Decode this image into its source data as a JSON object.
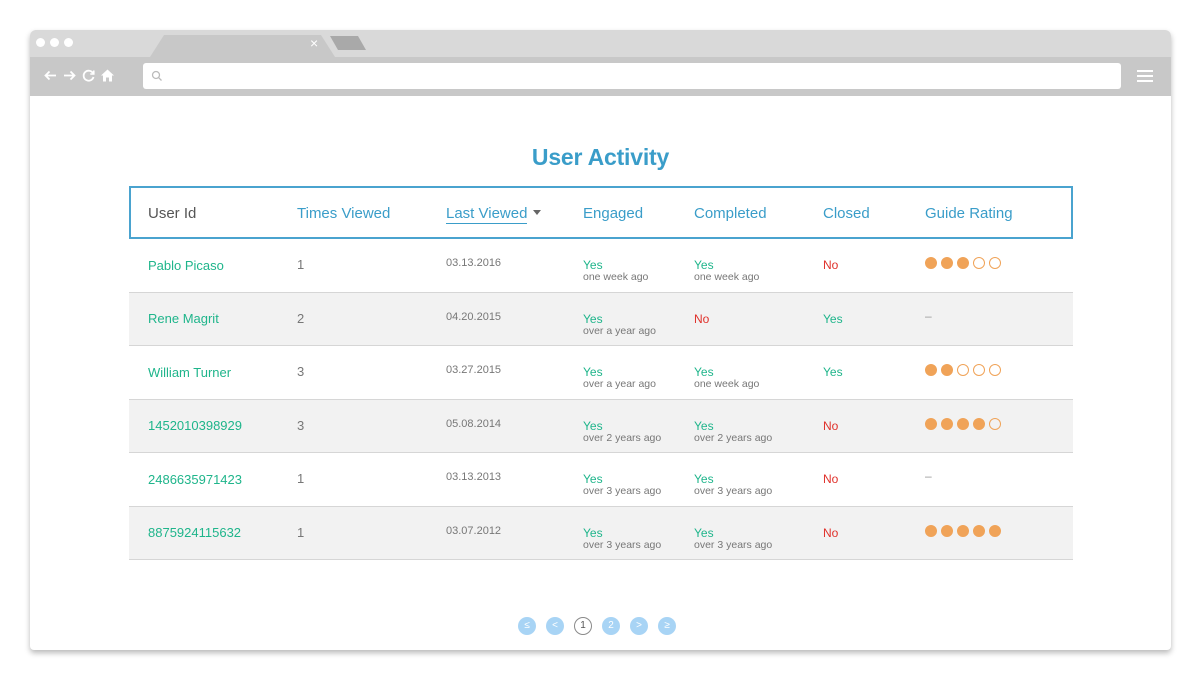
{
  "browser": {
    "tab_close": "×",
    "url_value": "",
    "icons": [
      "back-arrow-icon",
      "forward-arrow-icon",
      "reload-icon",
      "home-icon",
      "search-icon",
      "hamburger-menu-icon"
    ]
  },
  "page": {
    "title": "User Activity"
  },
  "table": {
    "headers": {
      "user_id": "User Id",
      "times_viewed": "Times Viewed",
      "last_viewed": "Last Viewed",
      "engaged": "Engaged",
      "completed": "Completed",
      "closed": "Closed",
      "guide_rating": "Guide Rating"
    },
    "sorted_column": "last_viewed",
    "sort_direction": "descending",
    "rows": [
      {
        "user": "Pablo Picaso",
        "times": "1",
        "date": "03.13.2016",
        "engaged": "Yes",
        "engaged_ago": "one week ago",
        "completed": "Yes",
        "completed_ago": "one week ago",
        "closed": "No",
        "rating": 3,
        "rating_max": 5,
        "dash": ""
      },
      {
        "user": "Rene Magrit",
        "times": "2",
        "date": "04.20.2015",
        "engaged": "Yes",
        "engaged_ago": "over a year ago",
        "completed": "No",
        "completed_ago": "",
        "closed": "Yes",
        "rating": null,
        "rating_max": 5,
        "dash": "–"
      },
      {
        "user": "William Turner",
        "times": "3",
        "date": "03.27.2015",
        "engaged": "Yes",
        "engaged_ago": "over a year ago",
        "completed": "Yes",
        "completed_ago": "one week ago",
        "closed": "Yes",
        "rating": 2,
        "rating_max": 5,
        "dash": ""
      },
      {
        "user": "1452010398929",
        "times": "3",
        "date": "05.08.2014",
        "engaged": "Yes",
        "engaged_ago": "over 2 years ago",
        "completed": "Yes",
        "completed_ago": "over 2 years ago",
        "closed": "No",
        "rating": 4,
        "rating_max": 5,
        "dash": ""
      },
      {
        "user": "2486635971423",
        "times": "1",
        "date": "03.13.2013",
        "engaged": "Yes",
        "engaged_ago": "over 3 years ago",
        "completed": "Yes",
        "completed_ago": "over 3 years ago",
        "closed": "No",
        "rating": null,
        "rating_max": 5,
        "dash": "–"
      },
      {
        "user": "8875924115632",
        "times": "1",
        "date": "03.07.2012",
        "engaged": "Yes",
        "engaged_ago": "over 3 years ago",
        "completed": "Yes",
        "completed_ago": "over 3 years ago",
        "closed": "No",
        "rating": 5,
        "rating_max": 5,
        "dash": ""
      }
    ]
  },
  "pagination": {
    "first": "≤",
    "prev": "<",
    "pages": [
      "1",
      "2"
    ],
    "current": "1",
    "next": ">",
    "last": "≥"
  },
  "colors": {
    "accent": "#3a9dc9",
    "yes": "#1fb58b",
    "no": "#e0312b",
    "rating": "#f0a358",
    "pager": "#a8d4f5"
  }
}
